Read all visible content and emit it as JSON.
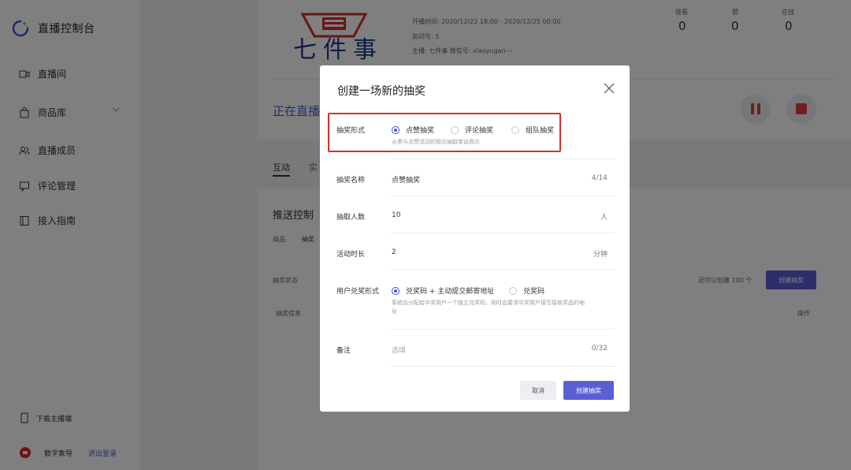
{
  "app": {
    "title": "直播控制台"
  },
  "sidebar": {
    "items": [
      {
        "label": "直播间",
        "icon": "video-icon"
      },
      {
        "label": "商品库",
        "icon": "shopping-bag-icon"
      },
      {
        "label": "直播成员",
        "icon": "members-icon"
      },
      {
        "label": "评论管理",
        "icon": "comment-icon"
      },
      {
        "label": "接入指南",
        "icon": "book-icon"
      }
    ],
    "download_label": "下载主播端",
    "user_name": "数字象导",
    "logout_label": "退出登录"
  },
  "live_info": {
    "logo_text": "七件事",
    "time": "开播时间:  2020/12/22 18:00 - 2020/12/25 00:00",
    "room": "房间号:  5",
    "host": "主播:  七件事    微信号:  xiaoyugan---",
    "stats": [
      {
        "label": "观看",
        "value": "0"
      },
      {
        "label": "赞",
        "value": "0"
      },
      {
        "label": "在线",
        "value": "0"
      }
    ]
  },
  "main": {
    "status_title": "正在直播",
    "tabs": [
      "互动",
      "实"
    ],
    "push_control_title": "推送控制",
    "sub_tabs": [
      "商品",
      "抽奖"
    ],
    "lottery_status_label": "抽奖状态",
    "lottery_info_label": "抽奖信息",
    "remaining_text": "还可以创建 100 个",
    "create_lottery_button": "创建抽奖",
    "operation_label": "操作"
  },
  "modal": {
    "title": "创建一场新的抽奖",
    "lottery_type": {
      "label": "抽奖形式",
      "options": [
        "点赞抽奖",
        "评论抽奖",
        "组队抽奖"
      ],
      "selected": 0,
      "hint": "从参与点赞活动的观众抽取幸运观众"
    },
    "lottery_name": {
      "label": "抽奖名称",
      "value": "点赞抽奖",
      "counter": "4/14"
    },
    "winner_count": {
      "label": "抽取人数",
      "value": "10",
      "unit": "人"
    },
    "duration": {
      "label": "活动时长",
      "value": "2",
      "unit": "分钟"
    },
    "redeem": {
      "label": "用户兑奖形式",
      "options": [
        "兑奖码 + 主动提交邮寄地址",
        "兑奖码"
      ],
      "selected": 0,
      "hint": "系统会分配给中奖用户一个独立兑奖码，同时会要求中奖用户填写接收奖品的地址"
    },
    "remark": {
      "label": "备注",
      "placeholder": "选填",
      "counter": "0/32"
    },
    "cancel_button": "取消",
    "create_button": "创建抽奖"
  },
  "colors": {
    "accent": "#5b5fd6",
    "highlight": "#e02a2a",
    "danger": "#e43a3a"
  }
}
